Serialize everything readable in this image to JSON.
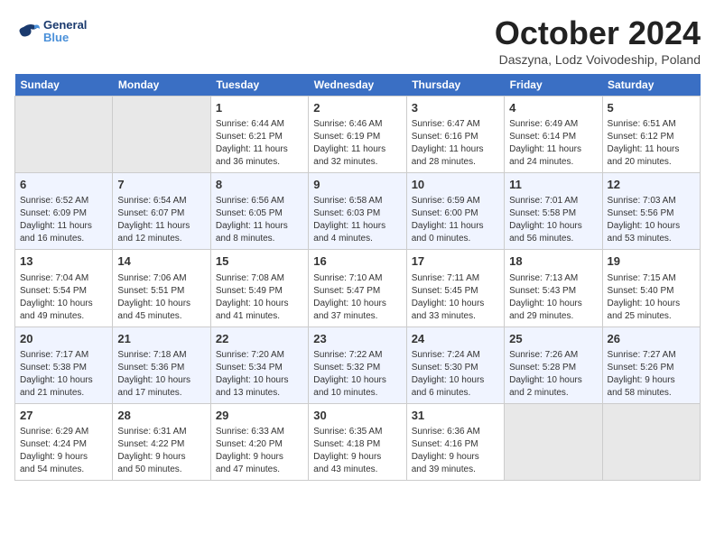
{
  "logo": {
    "line1": "General",
    "line2": "Blue"
  },
  "title": "October 2024",
  "location": "Daszyna, Lodz Voivodeship, Poland",
  "weekdays": [
    "Sunday",
    "Monday",
    "Tuesday",
    "Wednesday",
    "Thursday",
    "Friday",
    "Saturday"
  ],
  "weeks": [
    [
      {
        "num": "",
        "info": ""
      },
      {
        "num": "",
        "info": ""
      },
      {
        "num": "1",
        "info": "Sunrise: 6:44 AM\nSunset: 6:21 PM\nDaylight: 11 hours\nand 36 minutes."
      },
      {
        "num": "2",
        "info": "Sunrise: 6:46 AM\nSunset: 6:19 PM\nDaylight: 11 hours\nand 32 minutes."
      },
      {
        "num": "3",
        "info": "Sunrise: 6:47 AM\nSunset: 6:16 PM\nDaylight: 11 hours\nand 28 minutes."
      },
      {
        "num": "4",
        "info": "Sunrise: 6:49 AM\nSunset: 6:14 PM\nDaylight: 11 hours\nand 24 minutes."
      },
      {
        "num": "5",
        "info": "Sunrise: 6:51 AM\nSunset: 6:12 PM\nDaylight: 11 hours\nand 20 minutes."
      }
    ],
    [
      {
        "num": "6",
        "info": "Sunrise: 6:52 AM\nSunset: 6:09 PM\nDaylight: 11 hours\nand 16 minutes."
      },
      {
        "num": "7",
        "info": "Sunrise: 6:54 AM\nSunset: 6:07 PM\nDaylight: 11 hours\nand 12 minutes."
      },
      {
        "num": "8",
        "info": "Sunrise: 6:56 AM\nSunset: 6:05 PM\nDaylight: 11 hours\nand 8 minutes."
      },
      {
        "num": "9",
        "info": "Sunrise: 6:58 AM\nSunset: 6:03 PM\nDaylight: 11 hours\nand 4 minutes."
      },
      {
        "num": "10",
        "info": "Sunrise: 6:59 AM\nSunset: 6:00 PM\nDaylight: 11 hours\nand 0 minutes."
      },
      {
        "num": "11",
        "info": "Sunrise: 7:01 AM\nSunset: 5:58 PM\nDaylight: 10 hours\nand 56 minutes."
      },
      {
        "num": "12",
        "info": "Sunrise: 7:03 AM\nSunset: 5:56 PM\nDaylight: 10 hours\nand 53 minutes."
      }
    ],
    [
      {
        "num": "13",
        "info": "Sunrise: 7:04 AM\nSunset: 5:54 PM\nDaylight: 10 hours\nand 49 minutes."
      },
      {
        "num": "14",
        "info": "Sunrise: 7:06 AM\nSunset: 5:51 PM\nDaylight: 10 hours\nand 45 minutes."
      },
      {
        "num": "15",
        "info": "Sunrise: 7:08 AM\nSunset: 5:49 PM\nDaylight: 10 hours\nand 41 minutes."
      },
      {
        "num": "16",
        "info": "Sunrise: 7:10 AM\nSunset: 5:47 PM\nDaylight: 10 hours\nand 37 minutes."
      },
      {
        "num": "17",
        "info": "Sunrise: 7:11 AM\nSunset: 5:45 PM\nDaylight: 10 hours\nand 33 minutes."
      },
      {
        "num": "18",
        "info": "Sunrise: 7:13 AM\nSunset: 5:43 PM\nDaylight: 10 hours\nand 29 minutes."
      },
      {
        "num": "19",
        "info": "Sunrise: 7:15 AM\nSunset: 5:40 PM\nDaylight: 10 hours\nand 25 minutes."
      }
    ],
    [
      {
        "num": "20",
        "info": "Sunrise: 7:17 AM\nSunset: 5:38 PM\nDaylight: 10 hours\nand 21 minutes."
      },
      {
        "num": "21",
        "info": "Sunrise: 7:18 AM\nSunset: 5:36 PM\nDaylight: 10 hours\nand 17 minutes."
      },
      {
        "num": "22",
        "info": "Sunrise: 7:20 AM\nSunset: 5:34 PM\nDaylight: 10 hours\nand 13 minutes."
      },
      {
        "num": "23",
        "info": "Sunrise: 7:22 AM\nSunset: 5:32 PM\nDaylight: 10 hours\nand 10 minutes."
      },
      {
        "num": "24",
        "info": "Sunrise: 7:24 AM\nSunset: 5:30 PM\nDaylight: 10 hours\nand 6 minutes."
      },
      {
        "num": "25",
        "info": "Sunrise: 7:26 AM\nSunset: 5:28 PM\nDaylight: 10 hours\nand 2 minutes."
      },
      {
        "num": "26",
        "info": "Sunrise: 7:27 AM\nSunset: 5:26 PM\nDaylight: 9 hours\nand 58 minutes."
      }
    ],
    [
      {
        "num": "27",
        "info": "Sunrise: 6:29 AM\nSunset: 4:24 PM\nDaylight: 9 hours\nand 54 minutes."
      },
      {
        "num": "28",
        "info": "Sunrise: 6:31 AM\nSunset: 4:22 PM\nDaylight: 9 hours\nand 50 minutes."
      },
      {
        "num": "29",
        "info": "Sunrise: 6:33 AM\nSunset: 4:20 PM\nDaylight: 9 hours\nand 47 minutes."
      },
      {
        "num": "30",
        "info": "Sunrise: 6:35 AM\nSunset: 4:18 PM\nDaylight: 9 hours\nand 43 minutes."
      },
      {
        "num": "31",
        "info": "Sunrise: 6:36 AM\nSunset: 4:16 PM\nDaylight: 9 hours\nand 39 minutes."
      },
      {
        "num": "",
        "info": ""
      },
      {
        "num": "",
        "info": ""
      }
    ]
  ]
}
